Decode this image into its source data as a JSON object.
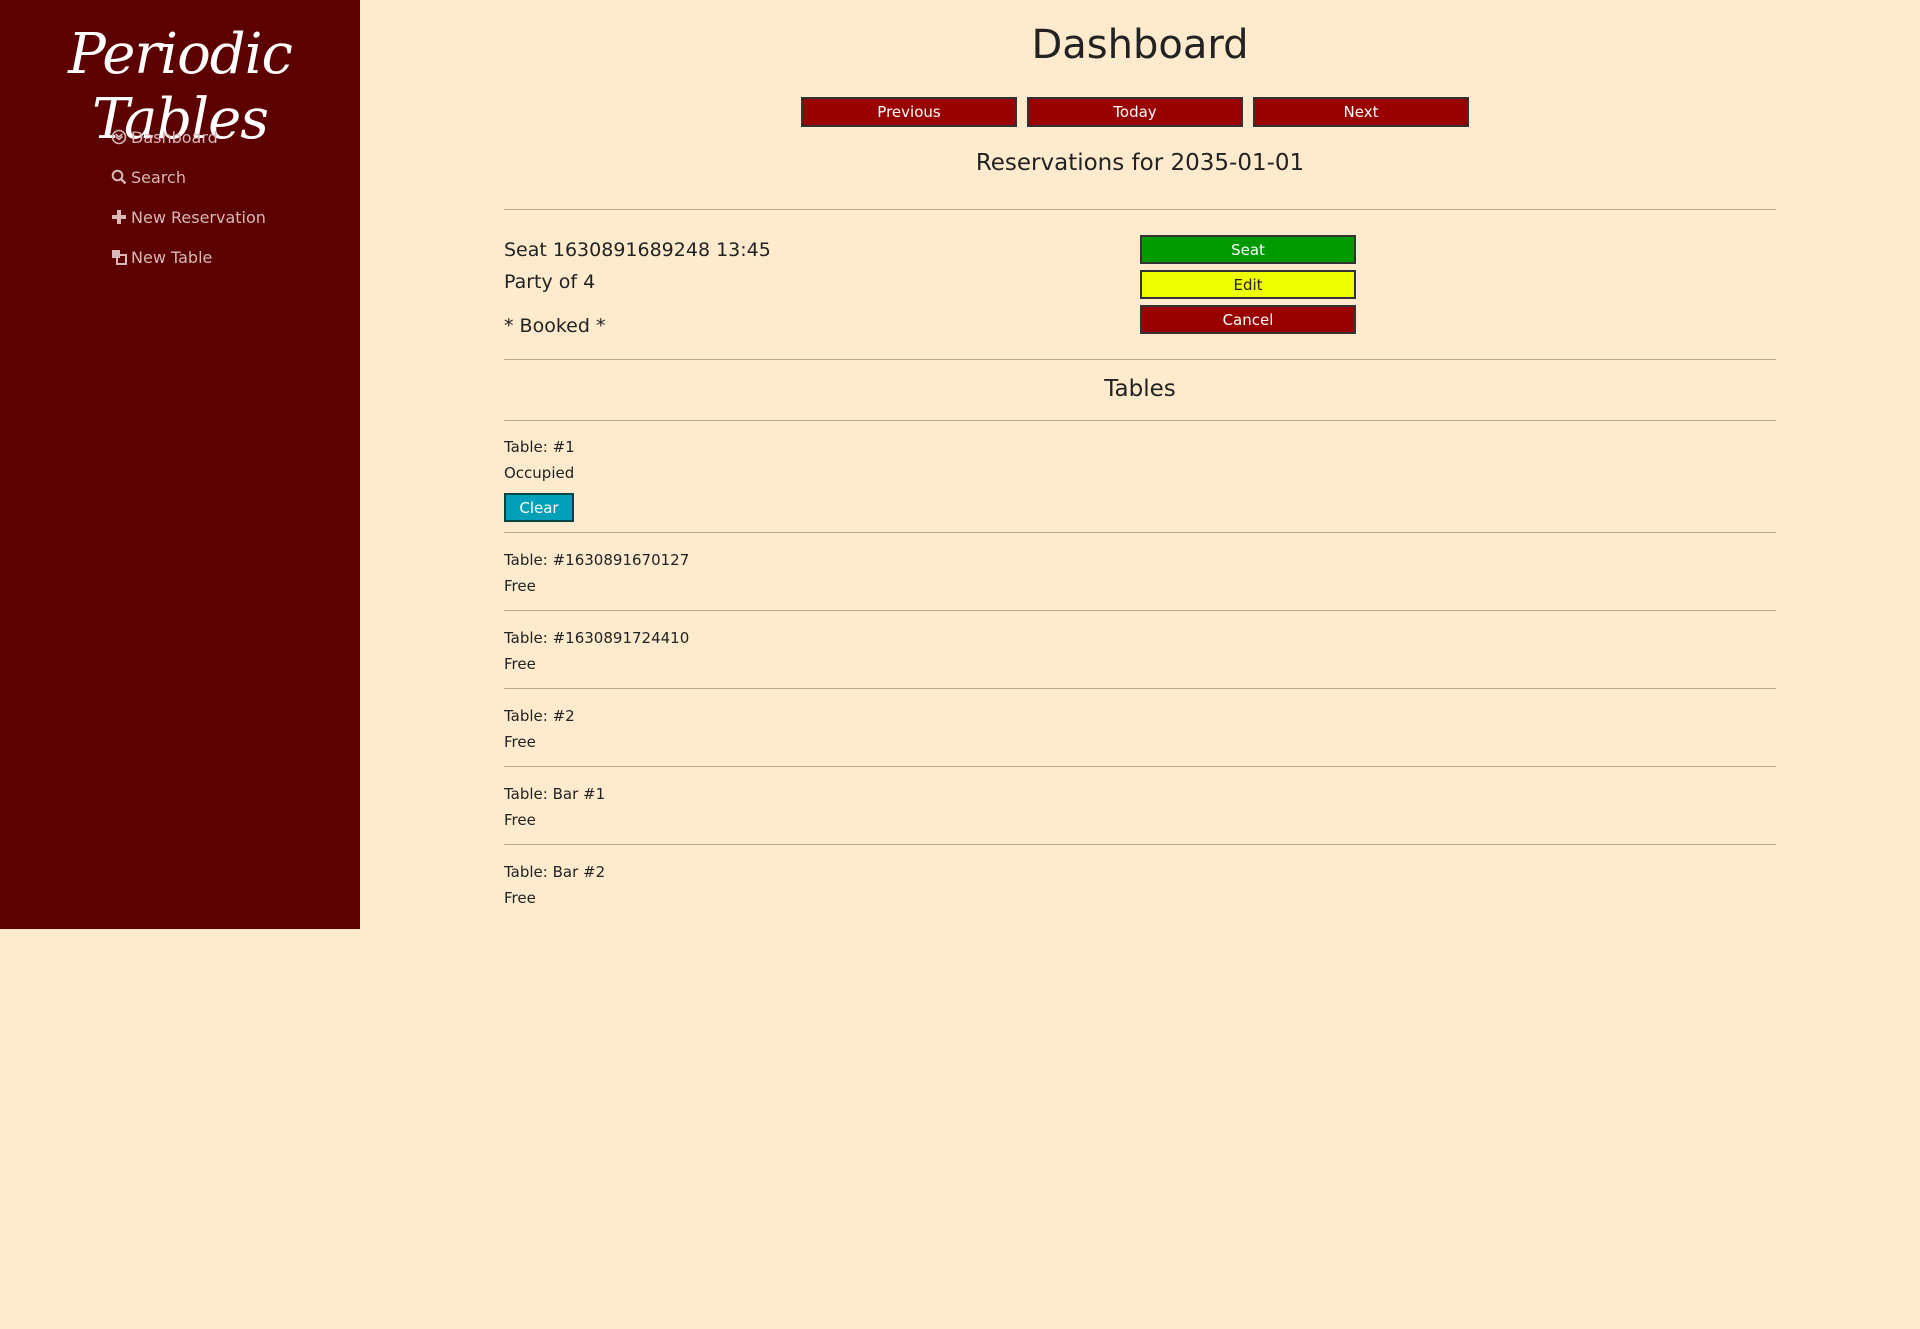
{
  "sidebar": {
    "brand": "Periodic Tables",
    "items": [
      {
        "label": "Dashboard",
        "icon": "dashboard-icon"
      },
      {
        "label": "Search",
        "icon": "search-icon"
      },
      {
        "label": "New Reservation",
        "icon": "plus-icon"
      },
      {
        "label": "New Table",
        "icon": "new-table-icon"
      }
    ]
  },
  "header": {
    "title": "Dashboard",
    "previous_label": "Previous",
    "today_label": "Today",
    "next_label": "Next"
  },
  "reservations": {
    "heading": "Reservations for 2035-01-01",
    "items": [
      {
        "title": "Seat 1630891689248 13:45",
        "party": "Party of 4",
        "status": "* Booked *",
        "seat_label": "Seat",
        "edit_label": "Edit",
        "cancel_label": "Cancel"
      }
    ]
  },
  "tables": {
    "heading": "Tables",
    "items": [
      {
        "name": "Table: #1",
        "status": "Occupied",
        "clear_label": "Clear"
      },
      {
        "name": "Table: #1630891670127",
        "status": "Free"
      },
      {
        "name": "Table: #1630891724410",
        "status": "Free"
      },
      {
        "name": "Table: #2",
        "status": "Free"
      },
      {
        "name": "Table: Bar #1",
        "status": "Free"
      },
      {
        "name": "Table: Bar #2",
        "status": "Free"
      }
    ]
  },
  "colors": {
    "sidebar_bg": "#5c0000",
    "page_bg": "#feebcd",
    "red_button": "#990000",
    "green_button": "#009900",
    "yellow_button": "#eeff00",
    "teal_button": "#00a0b8"
  }
}
